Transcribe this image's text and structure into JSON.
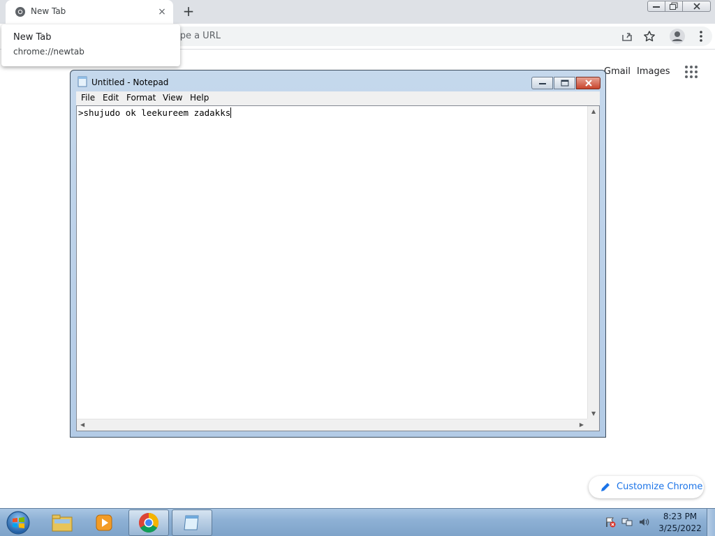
{
  "chrome": {
    "tab_title": "New Tab",
    "tab_close_glyph": "×",
    "new_tab_glyph": "+",
    "omnibox_placeholder": "ype a URL",
    "hover_card": {
      "title": "New Tab",
      "url": "chrome://newtab"
    },
    "ntp": {
      "gmail": "Gmail",
      "images": "Images",
      "customize": "Customize Chrome"
    }
  },
  "notepad": {
    "title": "Untitled - Notepad",
    "menu": {
      "file": "File",
      "edit": "Edit",
      "format": "Format",
      "view": "View",
      "help": "Help"
    },
    "text": ">shujudo ok leekureem zadakks"
  },
  "taskbar": {
    "time": "8:23 PM",
    "date": "3/25/2022"
  },
  "colors": {
    "accent": "#1a73e8",
    "tabstrip": "#dee1e6",
    "taskbar": "#8eb1d5"
  }
}
